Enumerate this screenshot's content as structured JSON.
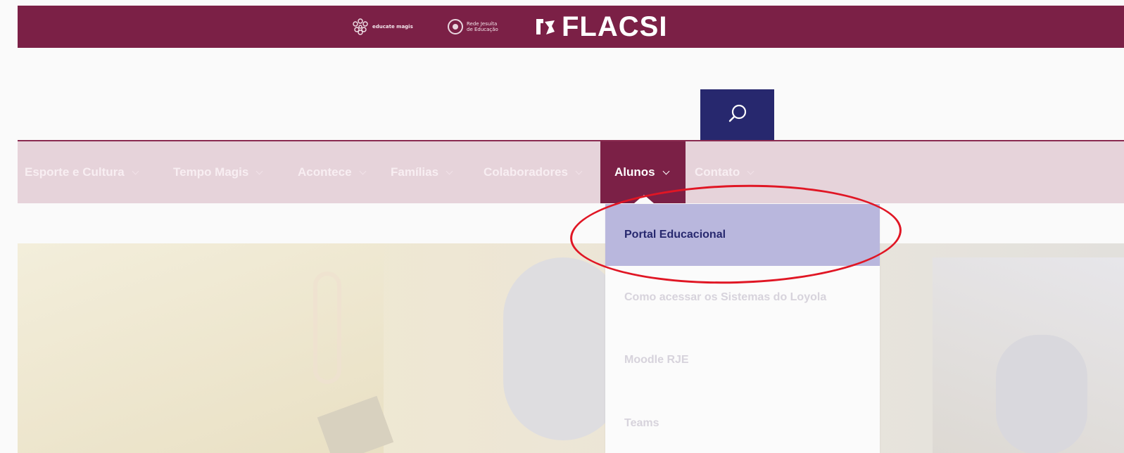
{
  "brand": {
    "educate_label": "educate magis",
    "rede_label": "Rede Jesuíta de Educação",
    "flacsi_label": "FLACSI",
    "bar_color": "#7b2046"
  },
  "search": {
    "icon": "search-icon",
    "bg_color": "#27286e"
  },
  "nav": {
    "items": [
      {
        "label": "Esporte e Cultura"
      },
      {
        "label": "Tempo Magis"
      },
      {
        "label": "Acontece"
      },
      {
        "label": "Famílias"
      },
      {
        "label": "Colaboradores"
      },
      {
        "label": "Alunos",
        "active": true
      },
      {
        "label": "Contato"
      }
    ]
  },
  "dropdown": {
    "items": [
      {
        "label": "Portal Educacional",
        "highlighted": true
      },
      {
        "label": "Como acessar os Sistemas do Loyola"
      },
      {
        "label": "Moodle RJE"
      },
      {
        "label": "Teams"
      }
    ],
    "highlight_color": "#b9b7dd"
  },
  "annotation": {
    "color": "#e01624"
  }
}
